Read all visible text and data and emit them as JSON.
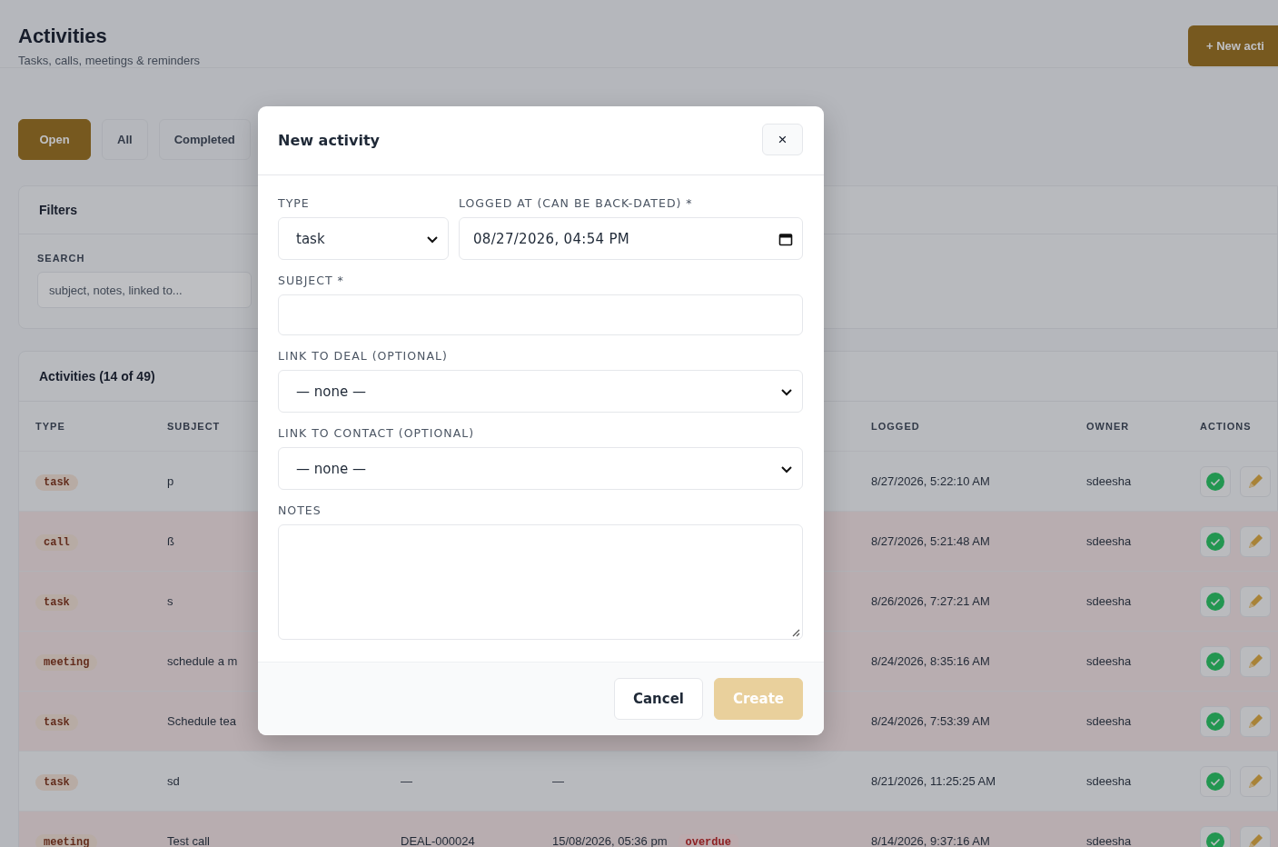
{
  "page": {
    "title": "Activities",
    "subtitle": "Tasks, calls, meetings & reminders",
    "new_button": "+ New acti"
  },
  "tabs": [
    {
      "label": "Open",
      "selected": true
    },
    {
      "label": "All",
      "selected": false
    },
    {
      "label": "Completed",
      "selected": false
    }
  ],
  "filters": {
    "title": "Filters",
    "search_label": "SEARCH",
    "search_placeholder": "subject, notes, linked to..."
  },
  "table": {
    "title": "Activities (14 of 49)",
    "header": {
      "type": "TYPE",
      "subject": "SUBJECT",
      "logged": "LOGGED",
      "owner": "OWNER",
      "actions": "ACTIONS"
    },
    "rows": [
      {
        "type": "task",
        "subject": "p",
        "logged": "8/27/2026, 5:22:10 AM",
        "owner": "sdeesha",
        "overdue": false
      },
      {
        "type": "call",
        "subject": "ß",
        "logged": "8/27/2026, 5:21:48 AM",
        "owner": "sdeesha",
        "overdue": true
      },
      {
        "type": "task",
        "subject": "s",
        "logged": "8/26/2026, 7:27:21 AM",
        "owner": "sdeesha",
        "overdue": true
      },
      {
        "type": "meeting",
        "subject": "schedule a m",
        "logged": "8/24/2026, 8:35:16 AM",
        "owner": "sdeesha",
        "overdue": true
      },
      {
        "type": "task",
        "subject": "Schedule tea",
        "logged": "8/24/2026, 7:53:39 AM",
        "owner": "sdeesha",
        "overdue": true
      },
      {
        "type": "task",
        "subject": "sd",
        "column_3": "—",
        "column_4": "—",
        "logged": "8/21/2026, 11:25:25 AM",
        "owner": "sdeesha",
        "overdue": false
      },
      {
        "type": "meeting",
        "subject": "Test call",
        "column_3": "DEAL-000024",
        "column_4": "15/08/2026, 05:36 pm",
        "due_badge": "overdue",
        "logged": "8/14/2026, 9:37:16 AM",
        "owner": "sdeesha",
        "overdue": true
      }
    ]
  },
  "modal": {
    "title": "New activity",
    "close": "×",
    "rows": [
      [
        {
          "kind": "select",
          "label": "TYPE",
          "value": "task"
        },
        {
          "kind": "datetime",
          "label": "LOGGED AT (CAN BE BACK-DATED) *",
          "value": "08/27/2026, 04:54 PM"
        }
      ],
      [
        {
          "kind": "text",
          "label": "SUBJECT *"
        }
      ],
      [
        {
          "kind": "select",
          "label": "LINK TO DEAL (OPTIONAL)",
          "value": "— none —"
        }
      ],
      [
        {
          "kind": "select",
          "label": "LINK TO CONTACT (OPTIONAL)",
          "value": "— none —"
        }
      ],
      [
        {
          "kind": "textarea",
          "label": "NOTES"
        }
      ]
    ],
    "buttons": [
      {
        "label": "Cancel",
        "kind": "secondary",
        "disabled": false
      },
      {
        "label": "Create",
        "kind": "primary",
        "disabled": true
      }
    ]
  }
}
